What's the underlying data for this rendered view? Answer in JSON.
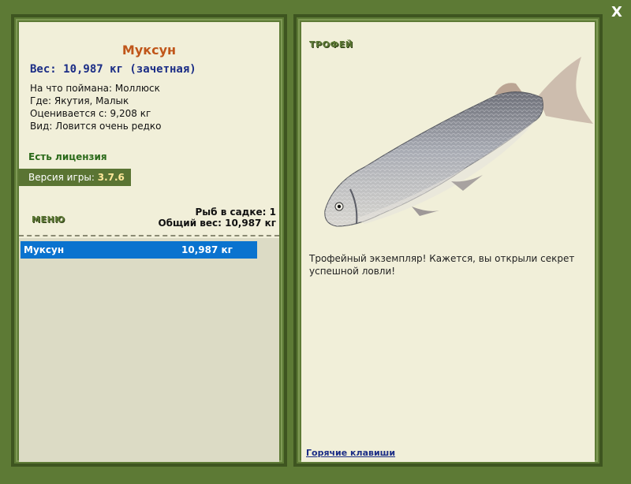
{
  "close_label": "X",
  "fish": {
    "name": "Муксун",
    "weight_line": "Вес: 10,987 кг (зачетная)",
    "details": [
      "На что поймана: Моллюск",
      "Где: Якутия, Малык",
      "Оценивается с: 9,208 кг",
      "Вид: Ловится очень редко"
    ]
  },
  "license_text": "Есть лицензия",
  "version": {
    "label": "Версия игры:",
    "number": "3.7.6"
  },
  "menu_label": "МЕНЮ",
  "cage": {
    "count_line": "Рыб в садке: 1",
    "total_line": "Общий вес: 10,987 кг",
    "items": [
      {
        "name": "Муксун",
        "weight": "10,987 кг"
      }
    ]
  },
  "trophy": {
    "title": "ТРОФЕЙ",
    "image_icon": "fish-whitefish-image",
    "message": "Трофейный экземпляр! Кажется, вы открыли секрет успешной ловли!"
  },
  "hotkeys_label": "Горячие клавиши",
  "colors": {
    "frame_green": "#5d7a35",
    "panel_bg": "#f1efd9",
    "selection_blue": "#0a73cf",
    "fish_name_orange": "#c0561a",
    "weight_blue": "#1b2d86"
  }
}
